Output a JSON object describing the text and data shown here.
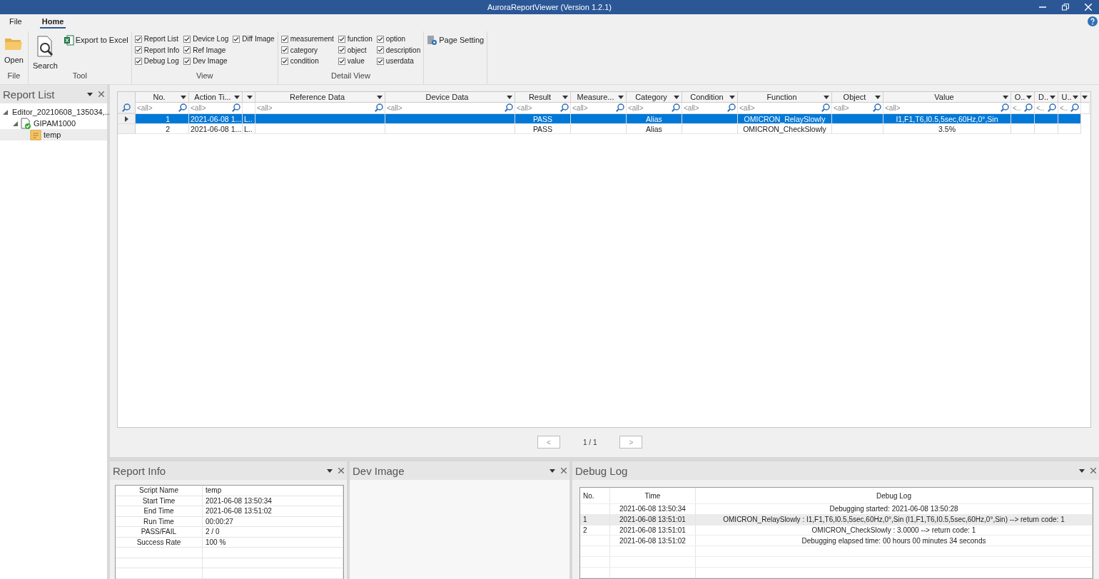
{
  "window": {
    "title": "AuroraReportViewer (Version 1.2.1)"
  },
  "ribbon_tabs": [
    {
      "label": "File",
      "selected": false
    },
    {
      "label": "Home",
      "selected": true
    }
  ],
  "ribbon_groups": [
    {
      "kind": "buttons",
      "label": "File",
      "buttons": [
        {
          "label": "Open"
        }
      ]
    },
    {
      "kind": "buttons",
      "label": "Tool",
      "buttons": [
        {
          "label": "Search"
        }
      ],
      "small_buttons": [
        {
          "label": "Export to Excel"
        }
      ]
    },
    {
      "kind": "checks",
      "label": "View",
      "columns": [
        [
          {
            "label": "Report List",
            "checked": true
          },
          {
            "label": "Report Info",
            "checked": true
          },
          {
            "label": "Debug Log",
            "checked": true
          }
        ],
        [
          {
            "label": "Device Log",
            "checked": true
          },
          {
            "label": "Ref Image",
            "checked": true
          },
          {
            "label": "Dev Image",
            "checked": true
          }
        ],
        [
          {
            "label": "Diff Image",
            "checked": true
          }
        ]
      ]
    },
    {
      "kind": "checks",
      "label": "Detail View",
      "columns": [
        [
          {
            "label": "measurement",
            "checked": true
          },
          {
            "label": "category",
            "checked": true
          },
          {
            "label": "condition",
            "checked": true
          }
        ],
        [
          {
            "label": "function",
            "checked": true
          },
          {
            "label": "object",
            "checked": true
          },
          {
            "label": "value",
            "checked": true
          }
        ],
        [
          {
            "label": "option",
            "checked": true
          },
          {
            "label": "description",
            "checked": true
          },
          {
            "label": "userdata",
            "checked": true
          }
        ]
      ]
    },
    {
      "kind": "buttons",
      "small_buttons": [
        {
          "label": "Page Setting"
        }
      ]
    }
  ],
  "report_list": {
    "title": "Report List",
    "tree": [
      {
        "label": "Editor_20210608_135034,...",
        "expanded": true,
        "selected": false,
        "children": [
          {
            "label": "GIPAM1000",
            "expanded": true,
            "selected": false,
            "children": [
              {
                "label": "temp",
                "selected": true
              }
            ]
          }
        ]
      }
    ]
  },
  "table": {
    "columns": [
      {
        "label": "No.",
        "placeholder": "<all>"
      },
      {
        "label": "Action Ti...",
        "placeholder": "<all>"
      },
      {},
      {
        "label": "Reference Data",
        "placeholder": "<all>"
      },
      {
        "label": "Device Data",
        "placeholder": "<all>"
      },
      {
        "label": "Result",
        "placeholder": "<all>"
      },
      {
        "label": "Measure...",
        "placeholder": "<all>"
      },
      {
        "label": "Category",
        "placeholder": "<all>"
      },
      {
        "label": "Condition",
        "placeholder": "<all>"
      },
      {
        "label": "Function",
        "placeholder": "<all>"
      },
      {
        "label": "Object",
        "placeholder": "<all>"
      },
      {
        "label": "Value",
        "placeholder": "<all>"
      },
      {
        "label": "O..",
        "placeholder": "<.."
      },
      {
        "label": "D..",
        "placeholder": "<.."
      },
      {
        "label": "U..",
        "placeholder": "<.."
      }
    ],
    "rows": [
      {
        "selected": true,
        "cells": [
          "1",
          "2021-06-08 1...",
          "L..",
          null,
          null,
          "PASS",
          null,
          "Alias",
          null,
          "OMICRON_RelaySlowly",
          null,
          "I1,F1,T6,I0.5,5sec,60Hz,0°,Sin",
          null,
          null,
          null
        ]
      },
      {
        "selected": false,
        "cells": [
          "2",
          "2021-06-08 1...",
          "L..",
          null,
          null,
          "PASS",
          null,
          "Alias",
          null,
          "OMICRON_CheckSlowly",
          null,
          "3.5%",
          null,
          null,
          null
        ]
      }
    ]
  },
  "pager": {
    "prev": "<",
    "page": "1 / 1",
    "next": ">"
  },
  "report_info": {
    "title": "Report Info",
    "rows": [
      {
        "label": "Script Name",
        "value": "temp"
      },
      {
        "label": "Start Time",
        "value": "2021-06-08 13:50:34"
      },
      {
        "label": "End Time",
        "value": "2021-06-08 13:51:02"
      },
      {
        "label": "Run Time",
        "value": "00:00:27"
      },
      {
        "label": "PASS/FAIL",
        "value": "2 / 0"
      },
      {
        "label": "Success Rate",
        "value": "100 %"
      }
    ]
  },
  "dev_image": {
    "title": "Dev Image"
  },
  "debug_log": {
    "title": "Debug Log",
    "columns": [
      "No.",
      "Time",
      "Debug Log"
    ],
    "rows": [
      {
        "selected": false,
        "time": "2021-06-08 13:50:34",
        "message": "Debugging started: 2021-06-08 13:50:28"
      },
      {
        "selected": true,
        "no": "1",
        "time": "2021-06-08 13:51:01",
        "message": "OMICRON_RelaySlowly : I1,F1,T6,I0.5,5sec,60Hz,0°,Sin (I1,F1,T6,I0.5,5sec,60Hz,0°,Sin)  --> return code: 1"
      },
      {
        "selected": false,
        "no": "2",
        "time": "2021-06-08 13:51:01",
        "message": "OMICRON_CheckSlowly : 3.0000 --> return code: 1"
      },
      {
        "selected": false,
        "time": "2021-06-08 13:51:02",
        "message": "Debugging elapsed time: 00 hours 00 minutes 34 seconds"
      }
    ]
  }
}
